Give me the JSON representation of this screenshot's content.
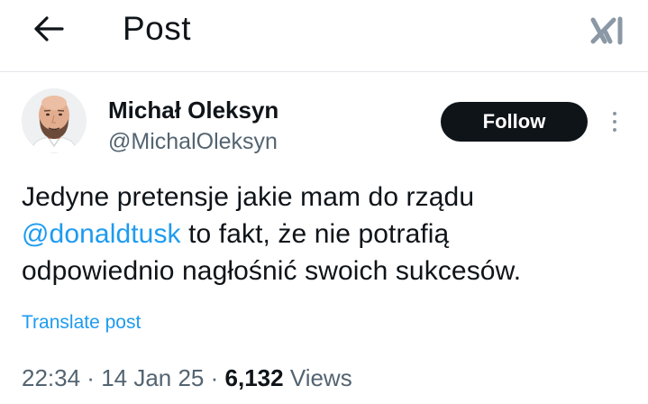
{
  "header": {
    "title": "Post",
    "back_icon": "arrow-left-icon",
    "grok_icon": "grok-icon"
  },
  "author": {
    "name": "Michał Oleksyn",
    "handle": "@MichalOleksyn",
    "avatar_icon": "avatar"
  },
  "actions": {
    "follow_label": "Follow",
    "more_icon": "more-vertical-icon"
  },
  "post": {
    "line1": "Jedyne pretensje jakie mam do rządu",
    "mention": "@donaldtusk",
    "line2_rest": " to fakt, że nie potrafią",
    "line3": "odpowiednio nagłośnić swoich sukcesów.",
    "translate_label": "Translate post"
  },
  "meta": {
    "time": "22:34",
    "separator1": " · ",
    "date": "14 Jan 25",
    "separator2": " · ",
    "views_count": "6,132",
    "views_label": " Views"
  },
  "colors": {
    "accent": "#1d9bf0",
    "text": "#0f1419",
    "secondary": "#536471",
    "follow_bg": "#0f1419"
  }
}
